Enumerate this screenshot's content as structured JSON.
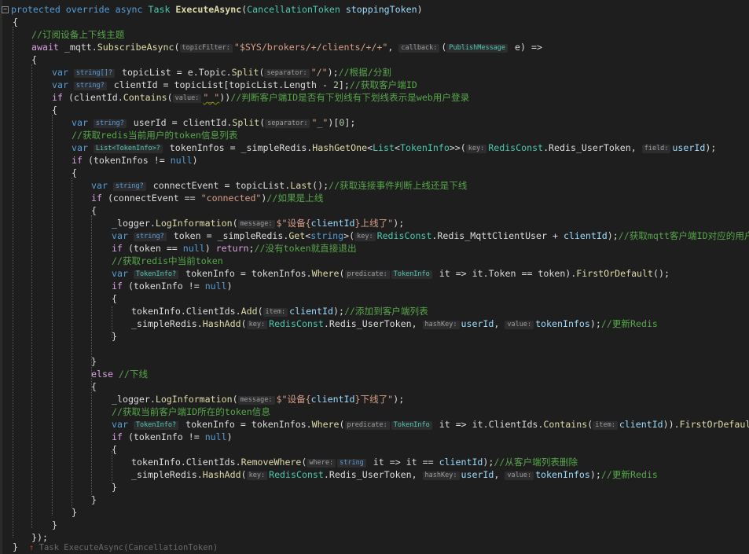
{
  "editor": {
    "l1": {
      "a": "protected override async ",
      "b": "Task ",
      "c": "ExecuteAsync",
      "d": "(",
      "e": "CancellationToken ",
      "f": "stoppingToken",
      ")": ")"
    },
    "l2": "{",
    "l3": "//订阅设备上下线主题",
    "l4": {
      "a": "await ",
      "b": "_mqtt.",
      "c": "SubscribeAsync",
      "d": "(",
      "h1": "topicFilter:",
      "s": "\"$SYS/brokers/+/clients/+/+\"",
      "e": ", ",
      "h2": "callback:",
      "f": "(",
      "h3": "PublishMessage",
      "g": " e) =>"
    },
    "l5": "{",
    "l6": {
      "a": "var ",
      "h1": "string[]?",
      "b": " topicList = e.",
      "c": "Topic",
      "d": ".",
      "e": "Split",
      "f": "(",
      "h2": "separator:",
      "s": "\"/\"",
      "g": ");",
      "cm": "//根据/分割"
    },
    "l7": {
      "a": "var ",
      "h1": "string?",
      "b": " clientId = topicList[topicList.Length - ",
      "n": "2",
      "c": "];",
      "cm": "//获取客户端ID"
    },
    "l8": {
      "a": "if ",
      "b": "(clientId.",
      "c": "Contains",
      "d": "(",
      "h1": "value:",
      "s": "\"_\"",
      "e": "))",
      "cm": "//判断客户端ID是否有下划线有下划线表示是web用户登录"
    },
    "l9": "{",
    "l10": {
      "a": "var ",
      "h1": "string?",
      "b": " userId = clientId.",
      "c": "Split",
      "d": "(",
      "h2": "separator:",
      "s": "\"_\"",
      "e": ")[",
      "n": "0",
      "f": "];"
    },
    "l11": "//获取redis当前用户的token信息列表",
    "l12": {
      "a": "var ",
      "h1": "List<TokenInfo>?",
      "b": " tokenInfos = _simpleRedis.",
      "c": "HashGetOne",
      "d": "<",
      "t1": "List",
      "e": "<",
      "t2": "TokenInfo",
      "f": ">>(",
      "h2": "key:",
      "t3": "RedisConst",
      "g": ".Redis_UserToken, ",
      "h3": "field:",
      "p": "userId",
      "z": ");"
    },
    "l13": {
      "a": "if ",
      "b": "(tokenInfos != ",
      "c": "null",
      ")": ")"
    },
    "l14": "{",
    "l15": {
      "a": "var ",
      "h1": "string?",
      "b": " connectEvent = topicList.",
      "c": "Last",
      "d": "();",
      "cm": "//获取连接事件判断上线还是下线"
    },
    "l16": {
      "a": "if ",
      "b": "(connectEvent == ",
      "s": "\"connected\"",
      "c": ")",
      "cm": "//如果是上线"
    },
    "l17": "{",
    "l18": {
      "a": "_logger.",
      "b": "LogInformation",
      "c": "(",
      "h1": "message:",
      "s1": "$\"设备{",
      "p": "clientId",
      "s2": "}上线了\"",
      "d": ");"
    },
    "l19": {
      "a": "var ",
      "h1": "string?",
      "b": " token = _simpleRedis.",
      "c": "Get",
      "d": "<",
      "k": "string",
      "e": ">(",
      "h2": "key:",
      "t": "RedisConst",
      "f": ".Redis_MqttClientUser + ",
      "p": "clientId",
      "g": ");",
      "cm": "//获取mqtt客户端ID对应的用户token"
    },
    "l20": {
      "a": "if ",
      "b": "(token == ",
      "c": "null",
      "d": ") ",
      "r": "return",
      "e": ";",
      "cm": "//没有token就直接退出"
    },
    "l21": "//获取redis中当前token",
    "l22": {
      "a": "var ",
      "h1": "TokenInfo?",
      "b": " tokenInfo = tokenInfos.",
      "c": "Where",
      "d": "(",
      "h2": "predicate:",
      "h3": "TokenInfo",
      "e": " it => it.Token == token).",
      "f": "FirstOrDefault",
      "g": "();"
    },
    "l23": {
      "a": "if ",
      "b": "(tokenInfo != ",
      "c": "null",
      ")": ")"
    },
    "l24": "{",
    "l25": {
      "a": "tokenInfo.ClientIds.",
      "b": "Add",
      "c": "(",
      "h1": "item:",
      "p": "clientId",
      "d": ");",
      "cm": "//添加到客户端列表"
    },
    "l26": {
      "a": "_simpleRedis.",
      "b": "HashAdd",
      "c": "(",
      "h1": "key:",
      "t": "RedisConst",
      "d": ".Redis_UserToken, ",
      "h2": "hashKey:",
      "p1": "userId",
      "e": ", ",
      "h3": "value:",
      "p2": "tokenInfos",
      "f": ");",
      "cm": "//更新Redis"
    },
    "l27": "}",
    "l29": "}",
    "l30": {
      "a": "else ",
      "cm": "//下线"
    },
    "l31": "{",
    "l32": {
      "a": "_logger.",
      "b": "LogInformation",
      "c": "(",
      "h1": "message:",
      "s1": "$\"设备{",
      "p": "clientId",
      "s2": "}下线了\"",
      "d": ");"
    },
    "l33": "//获取当前客户端ID所在的token信息",
    "l34": {
      "a": "var ",
      "h1": "TokenInfo?",
      "b": " tokenInfo = tokenInfos.",
      "c": "Where",
      "d": "(",
      "h2": "predicate:",
      "h3": "TokenInfo",
      "e": " it => it.ClientIds.",
      "f": "Contains",
      "g": "(",
      "h4": "item:",
      "p": "clientId",
      "h": ")).",
      "i": "FirstOrDefault",
      "j": "();"
    },
    "l35": {
      "a": "if ",
      "b": "(tokenInfo != ",
      "c": "null",
      ")": ")"
    },
    "l36": "{",
    "l37": {
      "a": "tokenInfo.ClientIds.",
      "b": "RemoveWhere",
      "c": "(",
      "h1": "where:",
      "k": "string",
      "d": " it => it == ",
      "p": "clientId",
      "e": ");",
      "cm": "//从客户端列表删除"
    },
    "l38": {
      "a": "_simpleRedis.",
      "b": "HashAdd",
      "c": "(",
      "h1": "key:",
      "t": "RedisConst",
      "d": ".Redis_UserToken, ",
      "h2": "hashKey:",
      "p1": "userId",
      "e": ", ",
      "h3": "value:",
      "p2": "tokenInfos",
      "f": ");",
      "cm": "//更新Redis"
    },
    "l39": "}",
    "l40": "}",
    "l41": "}",
    "l42": "}",
    "l43": "});",
    "l44": "}",
    "codelens": {
      "icon": "↑",
      "label": "Task ExecuteAsync(CancellationToken)"
    }
  },
  "colors": {
    "background": "#1e1e1e",
    "keyword": "#569cd6",
    "type": "#4ec9b0",
    "method": "#dcdcaa",
    "string": "#d69d85",
    "comment": "#57a64a",
    "control": "#d8a0df",
    "param": "#9cdcfe"
  }
}
